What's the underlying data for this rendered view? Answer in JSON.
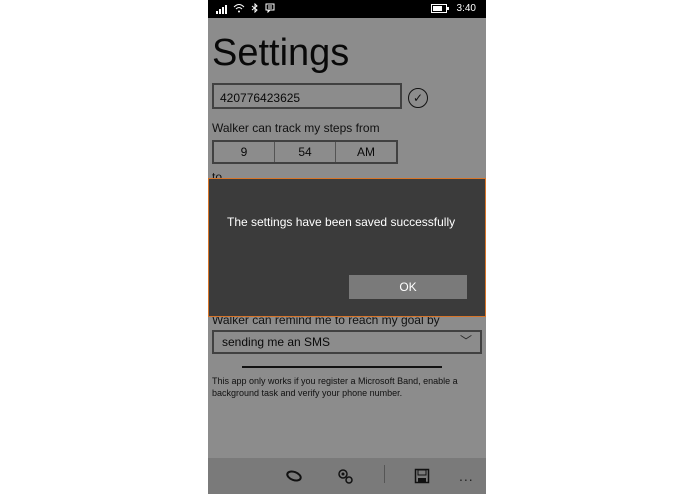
{
  "status_bar": {
    "time": "3:40"
  },
  "page": {
    "title": "Settings",
    "phone_number": "420776423625",
    "track_label": "Walker can track my steps from",
    "time_from": {
      "hour": "9",
      "minute": "54",
      "ampm": "AM"
    },
    "second_label_partial": "to",
    "remind_label": "Walker can remind me to reach my goal by",
    "remind_method": "sending me an SMS",
    "note": "This app only works if you register a Microsoft Band, enable a background task and verify your phone number."
  },
  "dialog": {
    "message": "The settings have been saved successfully",
    "ok_label": "OK"
  },
  "app_bar": {
    "icons": [
      "band-icon",
      "settings-icon",
      "save-icon"
    ],
    "more_label": "..."
  }
}
